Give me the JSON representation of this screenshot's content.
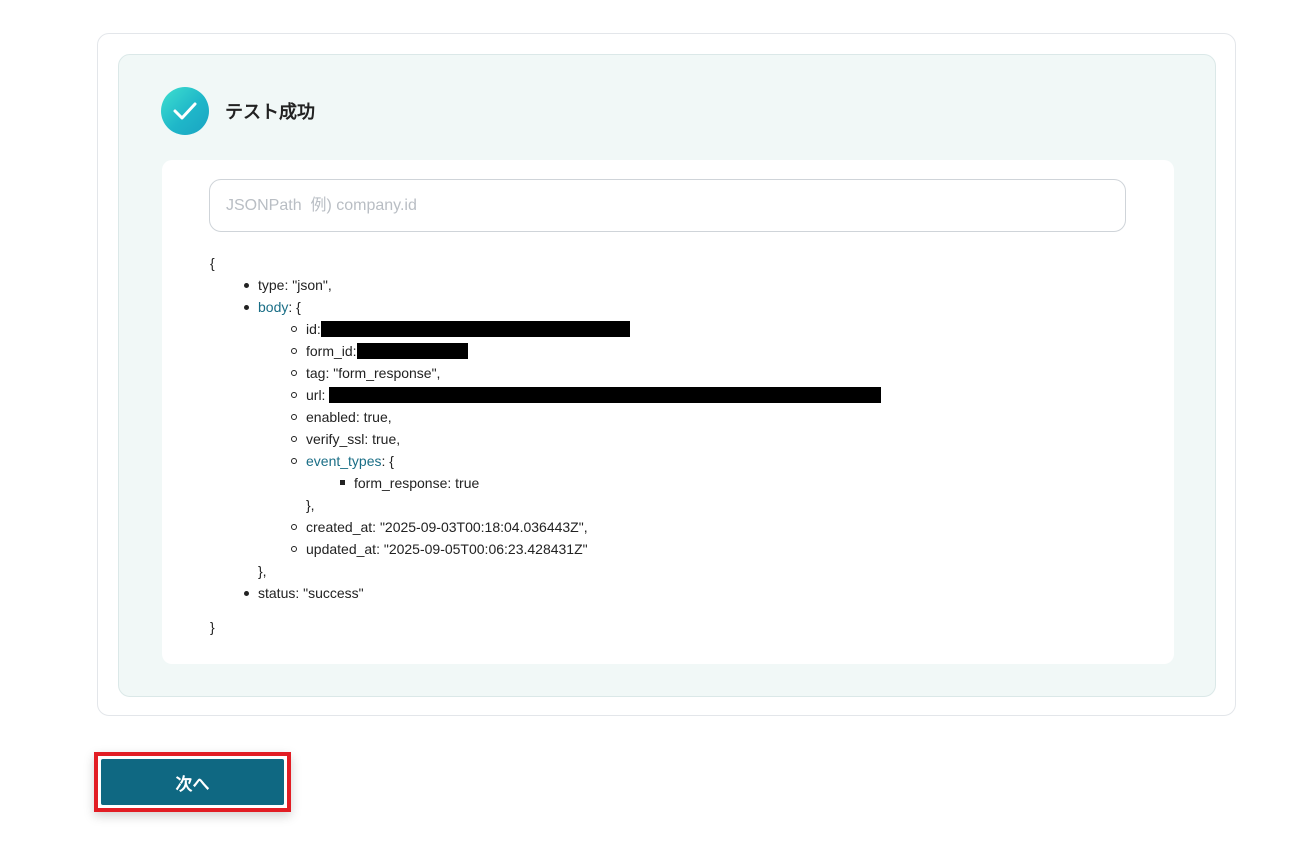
{
  "status": {
    "label": "テスト成功",
    "icon": "check-icon",
    "icon_gradient": [
      "#3fe0cf",
      "#1aa3c2"
    ]
  },
  "jsonpath": {
    "placeholder": "JSONPath  例) company.id",
    "value": ""
  },
  "json_tree": {
    "open_brace": "{",
    "close_brace": "}",
    "items": {
      "type": "type: \"json\",",
      "body_key": "body",
      "body_open": ": {",
      "body": {
        "id": "id:",
        "form_id": "form_id:",
        "tag": "tag: \"form_response\",",
        "url": "url:",
        "enabled": "enabled: true,",
        "verify_ssl": "verify_ssl: true,",
        "event_types_key": "event_types",
        "event_types_open": ": {",
        "event_types": {
          "form_response": "form_response: true"
        },
        "event_types_close": "},",
        "created_at": "created_at: \"2025-09-03T00:18:04.036443Z\",",
        "updated_at": "updated_at: \"2025-09-05T00:06:23.428431Z\""
      },
      "body_close": "},",
      "status": "status: \"success\""
    }
  },
  "next_button": {
    "label": "次へ",
    "color": "#0f6882",
    "highlight_color": "#e21d24"
  }
}
